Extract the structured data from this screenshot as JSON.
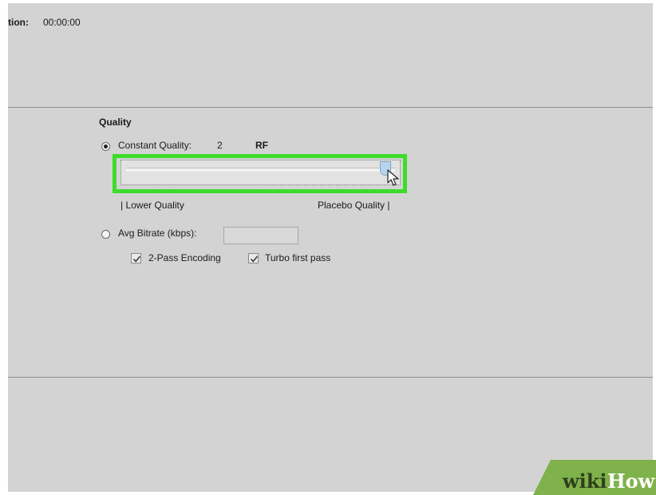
{
  "header": {
    "duration_label": "tion:",
    "duration_value": "00:00:00"
  },
  "quality": {
    "section_title": "Quality",
    "constant_quality_label": "Constant Quality:",
    "constant_quality_value": "2",
    "rf_label": "RF",
    "constant_quality_selected": true,
    "slider_value_fraction": 0.95,
    "lower_quality_label": "| Lower Quality",
    "placebo_quality_label": "Placebo Quality |",
    "avg_bitrate_label": "Avg Bitrate (kbps):",
    "avg_bitrate_value": "",
    "avg_bitrate_selected": false,
    "two_pass_label": "2-Pass Encoding",
    "two_pass_checked": true,
    "turbo_label": "Turbo first pass",
    "turbo_checked": true
  },
  "watermark": {
    "wiki": "wiki",
    "how": "How"
  },
  "colors": {
    "panel_background": "#d3d3d3",
    "highlight_border": "#3ddc2a",
    "watermark_green": "#7fb24b"
  }
}
